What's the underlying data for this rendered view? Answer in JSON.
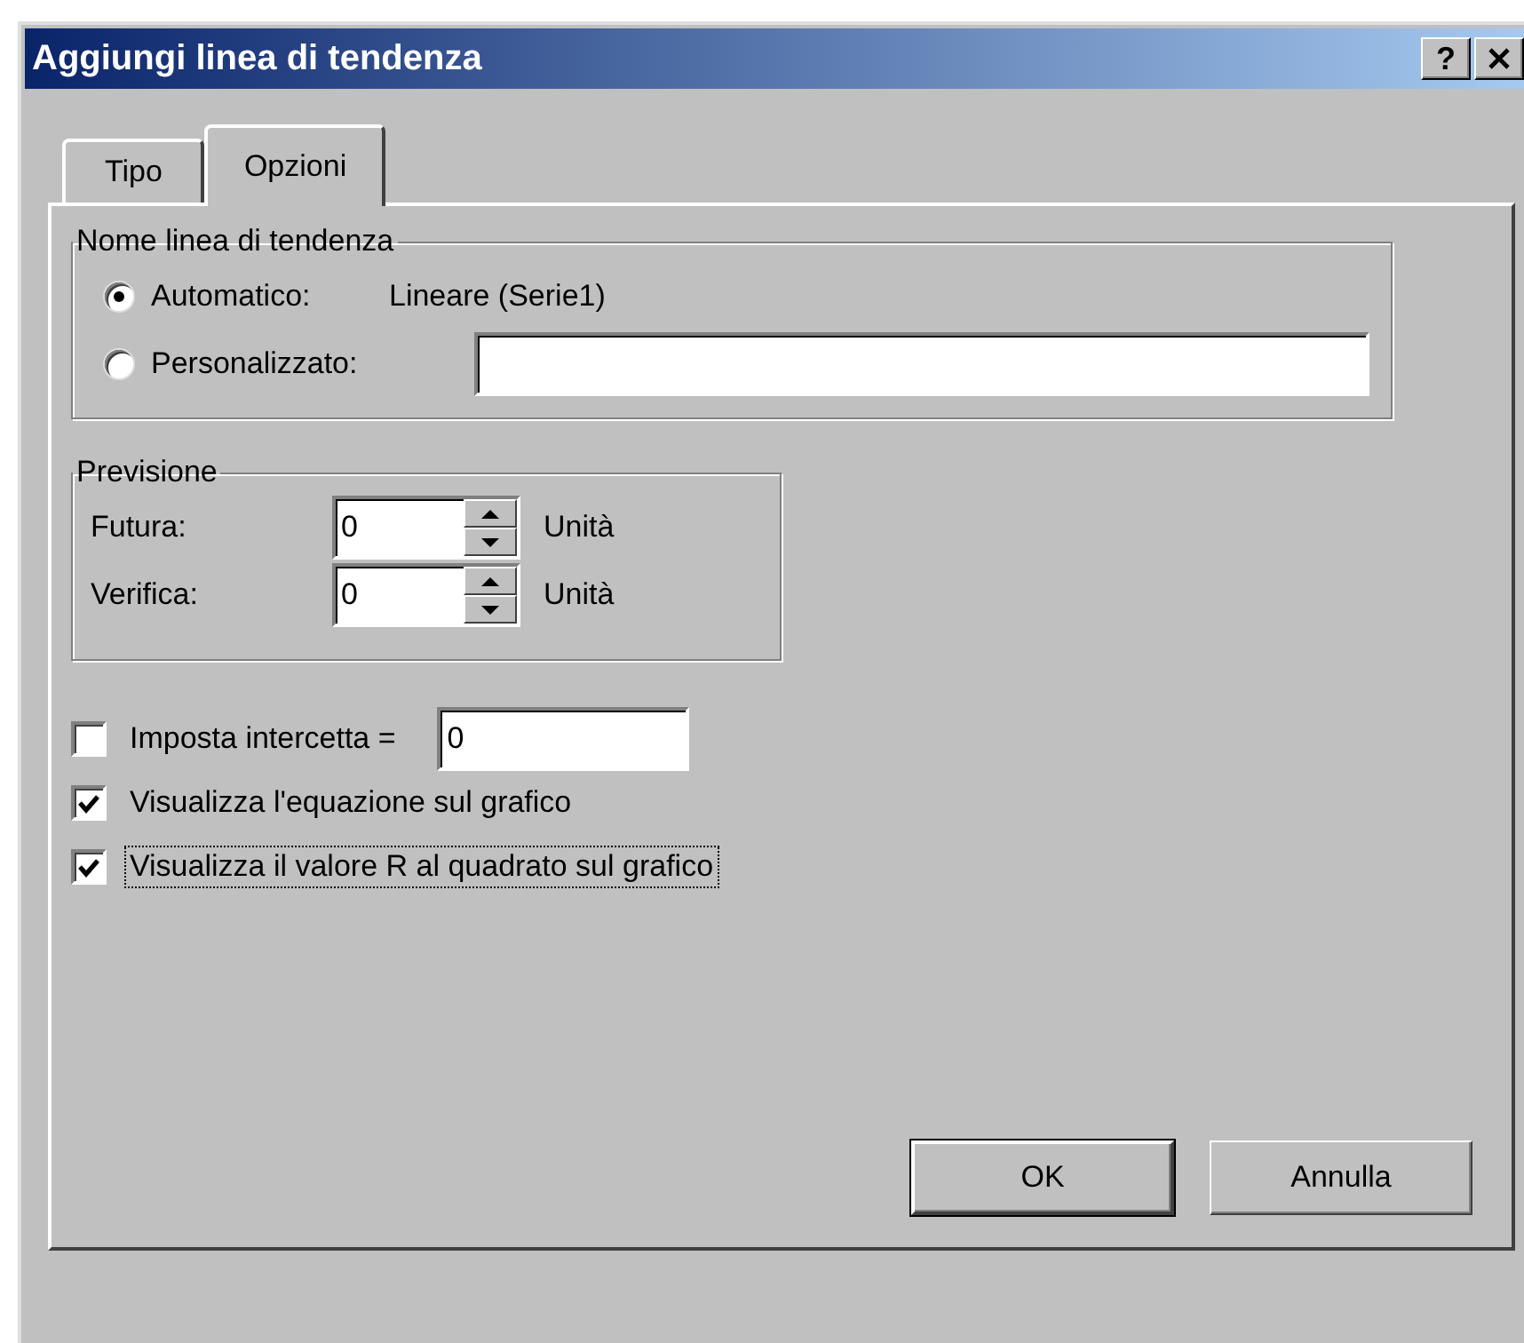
{
  "window": {
    "title": "Aggiungi linea di tendenza",
    "title_buttons": [
      {
        "kind": "help",
        "label": "?"
      },
      {
        "kind": "close"
      }
    ]
  },
  "tabs": [
    {
      "label": "Tipo",
      "selected": false
    },
    {
      "label": "Opzioni",
      "selected": true
    }
  ],
  "name_group": {
    "title": "Nome linea di tendenza",
    "options": [
      {
        "kind": "text",
        "label": "Automatico:",
        "selected": true,
        "value": "Lineare (Serie1)"
      },
      {
        "kind": "field",
        "label": "Personalizzato:",
        "selected": false
      }
    ]
  },
  "forecast_group": {
    "title": "Previsione",
    "rows": [
      {
        "label": "Futura:",
        "value": "0",
        "unit": "Unità"
      },
      {
        "label": "Verifica:",
        "value": "0",
        "unit": "Unità"
      }
    ]
  },
  "options": [
    {
      "label": "Imposta intercetta =",
      "checked": false,
      "focused": false,
      "field_value": "0"
    },
    {
      "label": "Visualizza l'equazione sul grafico",
      "checked": true,
      "focused": false
    },
    {
      "label": "Visualizza il valore R al quadrato sul grafico",
      "checked": true,
      "focused": true
    }
  ],
  "buttons": [
    {
      "label": "OK",
      "default": true
    },
    {
      "label": "Annulla",
      "default": false
    }
  ]
}
